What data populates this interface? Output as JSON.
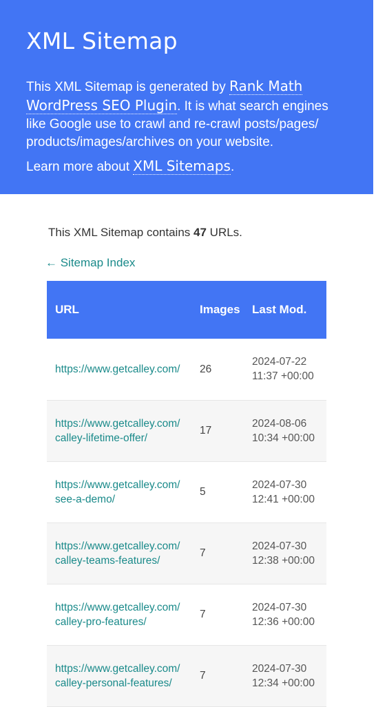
{
  "header": {
    "title": "XML Sitemap",
    "desc_prefix": "This XML Sitemap is generated by ",
    "desc_link": "Rank Math WordPress SEO Plugin",
    "desc_suffix": ". It is what search engines like Google use to crawl and re-crawl posts/pages/ products/images/archives on your website.",
    "learn_prefix": "Learn more about ",
    "learn_link": "XML Sitemaps",
    "learn_suffix": "."
  },
  "summary": {
    "prefix": "This XML Sitemap contains ",
    "count": "47",
    "suffix": " URLs."
  },
  "back_link": "← Sitemap Index",
  "table": {
    "headers": {
      "url": "URL",
      "images": "Images",
      "last_mod": "Last Mod."
    },
    "rows": [
      {
        "url": "https://www.getcalley.com/",
        "images": "26",
        "last_mod": "2024-07-22 11:37 +00:00"
      },
      {
        "url": "https://www.getcalley.com/ calley-lifetime-offer/",
        "images": "17",
        "last_mod": "2024-08-06 10:34 +00:00"
      },
      {
        "url": "https://www.getcalley.com/ see-a-demo/",
        "images": "5",
        "last_mod": "2024-07-30 12:41 +00:00"
      },
      {
        "url": "https://www.getcalley.com/ calley-teams-features/",
        "images": "7",
        "last_mod": "2024-07-30 12:38 +00:00"
      },
      {
        "url": "https://www.getcalley.com/ calley-pro-features/",
        "images": "7",
        "last_mod": "2024-07-30 12:36 +00:00"
      },
      {
        "url": "https://www.getcalley.com/ calley-personal-features/",
        "images": "7",
        "last_mod": "2024-07-30 12:34 +00:00"
      }
    ]
  },
  "colors": {
    "header_bg": "#4275f4",
    "link": "#1a8a8a",
    "row_alt": "#f6f6f6"
  }
}
